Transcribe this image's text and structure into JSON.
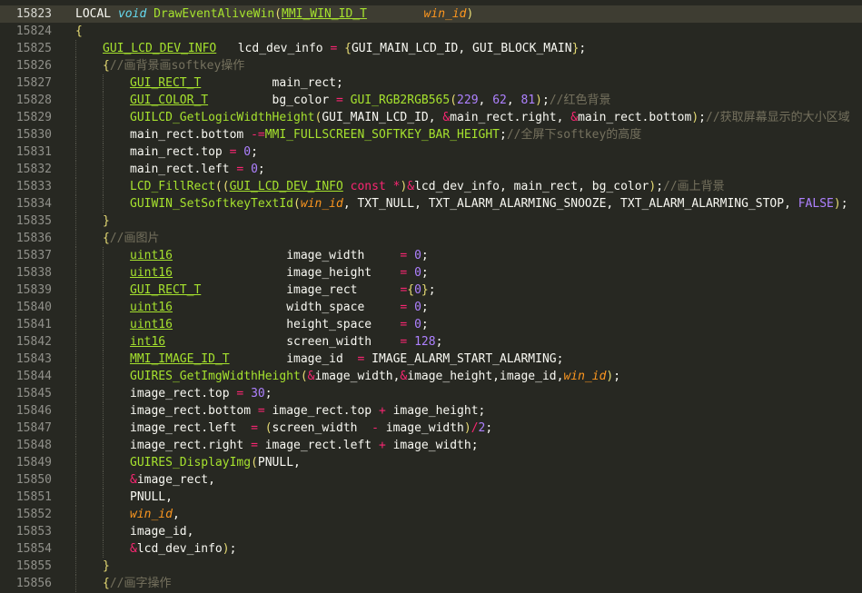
{
  "editor": {
    "current_line": 15823,
    "lines": [
      {
        "n": "15823",
        "t": [
          [
            "LOCAL ",
            "pl"
          ],
          [
            "void",
            "st"
          ],
          [
            " ",
            "pl"
          ],
          [
            "DrawEventAliveWin",
            "fn"
          ],
          [
            "(",
            "br"
          ],
          [
            "MMI_WIN_ID_T",
            "ty"
          ],
          [
            "        ",
            "pl"
          ],
          [
            "win_id",
            "pa"
          ],
          [
            ")",
            "br"
          ]
        ]
      },
      {
        "n": "15824",
        "t": [
          [
            "{",
            "br"
          ]
        ]
      },
      {
        "n": "15825",
        "i": 1,
        "t": [
          [
            "GUI_LCD_DEV_INFO",
            "ty"
          ],
          [
            "   lcd_dev_info ",
            "pl"
          ],
          [
            "=",
            "op"
          ],
          [
            " ",
            "pl"
          ],
          [
            "{",
            "br"
          ],
          [
            "GUI_MAIN_LCD_ID, GUI_BLOCK_MAIN",
            "pl"
          ],
          [
            "}",
            "br"
          ],
          [
            ";",
            "pl"
          ]
        ]
      },
      {
        "n": "15826",
        "i": 1,
        "t": [
          [
            "{",
            "br"
          ],
          [
            "//画背景画softkey操作",
            "cm"
          ]
        ]
      },
      {
        "n": "15827",
        "i": 2,
        "t": [
          [
            "GUI_RECT_T",
            "ty"
          ],
          [
            "          main_rect;",
            "pl"
          ]
        ]
      },
      {
        "n": "15828",
        "i": 2,
        "t": [
          [
            "GUI_COLOR_T",
            "ty"
          ],
          [
            "         bg_color ",
            "pl"
          ],
          [
            "=",
            "op"
          ],
          [
            " ",
            "pl"
          ],
          [
            "GUI_RGB2RGB565",
            "fn"
          ],
          [
            "(",
            "br"
          ],
          [
            "229",
            "nu"
          ],
          [
            ", ",
            "pl"
          ],
          [
            "62",
            "nu"
          ],
          [
            ", ",
            "pl"
          ],
          [
            "81",
            "nu"
          ],
          [
            ")",
            "br"
          ],
          [
            ";",
            "pl"
          ],
          [
            "//红色背景",
            "cm"
          ]
        ]
      },
      {
        "n": "15829",
        "i": 2,
        "t": [
          [
            "GUILCD_GetLogicWidthHeight",
            "fn"
          ],
          [
            "(",
            "br"
          ],
          [
            "GUI_MAIN_LCD_ID, ",
            "pl"
          ],
          [
            "&",
            "op"
          ],
          [
            "main_rect.right, ",
            "pl"
          ],
          [
            "&",
            "op"
          ],
          [
            "main_rect.bottom",
            "pl"
          ],
          [
            ")",
            "br"
          ],
          [
            ";",
            "pl"
          ],
          [
            "//获取屏幕显示的大小区域",
            "cm"
          ]
        ]
      },
      {
        "n": "15830",
        "i": 2,
        "t": [
          [
            "main_rect.bottom ",
            "pl"
          ],
          [
            "-=",
            "op"
          ],
          [
            "MMI_FULLSCREEN_SOFTKEY_BAR_HEIGHT",
            "mc"
          ],
          [
            ";",
            "pl"
          ],
          [
            "//全屏下softkey的高度",
            "cm"
          ]
        ]
      },
      {
        "n": "15831",
        "i": 2,
        "t": [
          [
            "main_rect.top ",
            "pl"
          ],
          [
            "=",
            "op"
          ],
          [
            " ",
            "pl"
          ],
          [
            "0",
            "nu"
          ],
          [
            ";",
            "pl"
          ]
        ]
      },
      {
        "n": "15832",
        "i": 2,
        "t": [
          [
            "main_rect.left ",
            "pl"
          ],
          [
            "=",
            "op"
          ],
          [
            " ",
            "pl"
          ],
          [
            "0",
            "nu"
          ],
          [
            ";",
            "pl"
          ]
        ]
      },
      {
        "n": "15833",
        "i": 2,
        "t": [
          [
            "LCD_FillRect",
            "fn"
          ],
          [
            "(",
            "br"
          ],
          [
            "(",
            "br"
          ],
          [
            "GUI_LCD_DEV_INFO",
            "ty"
          ],
          [
            " ",
            "pl"
          ],
          [
            "const",
            "kw"
          ],
          [
            " ",
            "pl"
          ],
          [
            "*",
            "op"
          ],
          [
            ")",
            "br"
          ],
          [
            "&",
            "op"
          ],
          [
            "lcd_dev_info, main_rect, bg_color",
            "pl"
          ],
          [
            ")",
            "br"
          ],
          [
            ";",
            "pl"
          ],
          [
            "//画上背景",
            "cm"
          ]
        ]
      },
      {
        "n": "15834",
        "i": 2,
        "t": [
          [
            "GUIWIN_SetSoftkeyTextId",
            "fn"
          ],
          [
            "(",
            "br"
          ],
          [
            "win_id",
            "pa"
          ],
          [
            ", TXT_NULL, TXT_ALARM_ALARMING_SNOOZE, TXT_ALARM_ALARMING_STOP, ",
            "pl"
          ],
          [
            "FALSE",
            "cs"
          ],
          [
            ")",
            "br"
          ],
          [
            ";",
            "pl"
          ]
        ]
      },
      {
        "n": "15835",
        "i": 1,
        "t": [
          [
            "}",
            "br"
          ]
        ]
      },
      {
        "n": "15836",
        "i": 1,
        "t": [
          [
            "{",
            "br"
          ],
          [
            "//画图片",
            "cm"
          ]
        ]
      },
      {
        "n": "15837",
        "i": 2,
        "t": [
          [
            "uint16",
            "ty"
          ],
          [
            "                image_width     ",
            "pl"
          ],
          [
            "=",
            "op"
          ],
          [
            " ",
            "pl"
          ],
          [
            "0",
            "nu"
          ],
          [
            ";",
            "pl"
          ]
        ]
      },
      {
        "n": "15838",
        "i": 2,
        "t": [
          [
            "uint16",
            "ty"
          ],
          [
            "                image_height    ",
            "pl"
          ],
          [
            "=",
            "op"
          ],
          [
            " ",
            "pl"
          ],
          [
            "0",
            "nu"
          ],
          [
            ";",
            "pl"
          ]
        ]
      },
      {
        "n": "15839",
        "i": 2,
        "t": [
          [
            "GUI_RECT_T",
            "ty"
          ],
          [
            "            image_rect      ",
            "pl"
          ],
          [
            "=",
            "op"
          ],
          [
            "{",
            "br"
          ],
          [
            "0",
            "nu"
          ],
          [
            "}",
            "br"
          ],
          [
            ";",
            "pl"
          ]
        ]
      },
      {
        "n": "15840",
        "i": 2,
        "t": [
          [
            "uint16",
            "ty"
          ],
          [
            "                width_space     ",
            "pl"
          ],
          [
            "=",
            "op"
          ],
          [
            " ",
            "pl"
          ],
          [
            "0",
            "nu"
          ],
          [
            ";",
            "pl"
          ]
        ]
      },
      {
        "n": "15841",
        "i": 2,
        "t": [
          [
            "uint16",
            "ty"
          ],
          [
            "                height_space    ",
            "pl"
          ],
          [
            "=",
            "op"
          ],
          [
            " ",
            "pl"
          ],
          [
            "0",
            "nu"
          ],
          [
            ";",
            "pl"
          ]
        ]
      },
      {
        "n": "15842",
        "i": 2,
        "t": [
          [
            "int16",
            "ty"
          ],
          [
            "                 screen_width    ",
            "pl"
          ],
          [
            "=",
            "op"
          ],
          [
            " ",
            "pl"
          ],
          [
            "128",
            "nu"
          ],
          [
            ";",
            "pl"
          ]
        ]
      },
      {
        "n": "15843",
        "i": 2,
        "t": [
          [
            "MMI_IMAGE_ID_T",
            "ty"
          ],
          [
            "        image_id  ",
            "pl"
          ],
          [
            "=",
            "op"
          ],
          [
            " ",
            "pl"
          ],
          [
            "IMAGE_ALARM_START_ALARMING;",
            "pl"
          ]
        ]
      },
      {
        "n": "15844",
        "i": 2,
        "t": [
          [
            "GUIRES_GetImgWidthHeight",
            "fn"
          ],
          [
            "(",
            "br"
          ],
          [
            "&",
            "op"
          ],
          [
            "image_width,",
            "pl"
          ],
          [
            "&",
            "op"
          ],
          [
            "image_height,image_id,",
            "pl"
          ],
          [
            "win_id",
            "pa"
          ],
          [
            ")",
            "br"
          ],
          [
            ";",
            "pl"
          ]
        ]
      },
      {
        "n": "15845",
        "i": 2,
        "t": [
          [
            "image_rect.top ",
            "pl"
          ],
          [
            "=",
            "op"
          ],
          [
            " ",
            "pl"
          ],
          [
            "30",
            "nu"
          ],
          [
            ";",
            "pl"
          ]
        ]
      },
      {
        "n": "15846",
        "i": 2,
        "t": [
          [
            "image_rect.bottom ",
            "pl"
          ],
          [
            "=",
            "op"
          ],
          [
            " image_rect.top ",
            "pl"
          ],
          [
            "+",
            "op"
          ],
          [
            " image_height;",
            "pl"
          ]
        ]
      },
      {
        "n": "15847",
        "i": 2,
        "t": [
          [
            "image_rect.left  ",
            "pl"
          ],
          [
            "=",
            "op"
          ],
          [
            " ",
            "pl"
          ],
          [
            "(",
            "br"
          ],
          [
            "screen_width  ",
            "pl"
          ],
          [
            "-",
            "op"
          ],
          [
            " image_width",
            "pl"
          ],
          [
            ")",
            "br"
          ],
          [
            "/",
            "op"
          ],
          [
            "2",
            "nu"
          ],
          [
            ";",
            "pl"
          ]
        ]
      },
      {
        "n": "15848",
        "i": 2,
        "t": [
          [
            "image_rect.right ",
            "pl"
          ],
          [
            "=",
            "op"
          ],
          [
            " image_rect.left ",
            "pl"
          ],
          [
            "+",
            "op"
          ],
          [
            " image_width;",
            "pl"
          ]
        ]
      },
      {
        "n": "15849",
        "i": 2,
        "t": [
          [
            "GUIRES_DisplayImg",
            "fn"
          ],
          [
            "(",
            "br"
          ],
          [
            "PNULL,",
            "pl"
          ]
        ]
      },
      {
        "n": "15850",
        "i": 2,
        "t": [
          [
            "&",
            "op"
          ],
          [
            "image_rect,",
            "pl"
          ]
        ]
      },
      {
        "n": "15851",
        "i": 2,
        "t": [
          [
            "PNULL,",
            "pl"
          ]
        ]
      },
      {
        "n": "15852",
        "i": 2,
        "t": [
          [
            "win_id",
            "pa"
          ],
          [
            ",",
            "pl"
          ]
        ]
      },
      {
        "n": "15853",
        "i": 2,
        "t": [
          [
            "image_id,",
            "pl"
          ]
        ]
      },
      {
        "n": "15854",
        "i": 2,
        "t": [
          [
            "&",
            "op"
          ],
          [
            "lcd_dev_info",
            "pl"
          ],
          [
            ")",
            "br"
          ],
          [
            ";",
            "pl"
          ]
        ]
      },
      {
        "n": "15855",
        "i": 1,
        "t": [
          [
            "}",
            "br"
          ]
        ]
      },
      {
        "n": "15856",
        "i": 1,
        "t": [
          [
            "{",
            "br"
          ],
          [
            "//画字操作",
            "cm"
          ]
        ]
      }
    ]
  },
  "theme": {
    "background": "#272822",
    "current_line": "#3e3d32",
    "comment": "#75715e",
    "keyword": "#f92672",
    "function": "#a6e22e",
    "number": "#ae81ff",
    "parameter": "#fd971f",
    "brace": "#e6db74"
  }
}
